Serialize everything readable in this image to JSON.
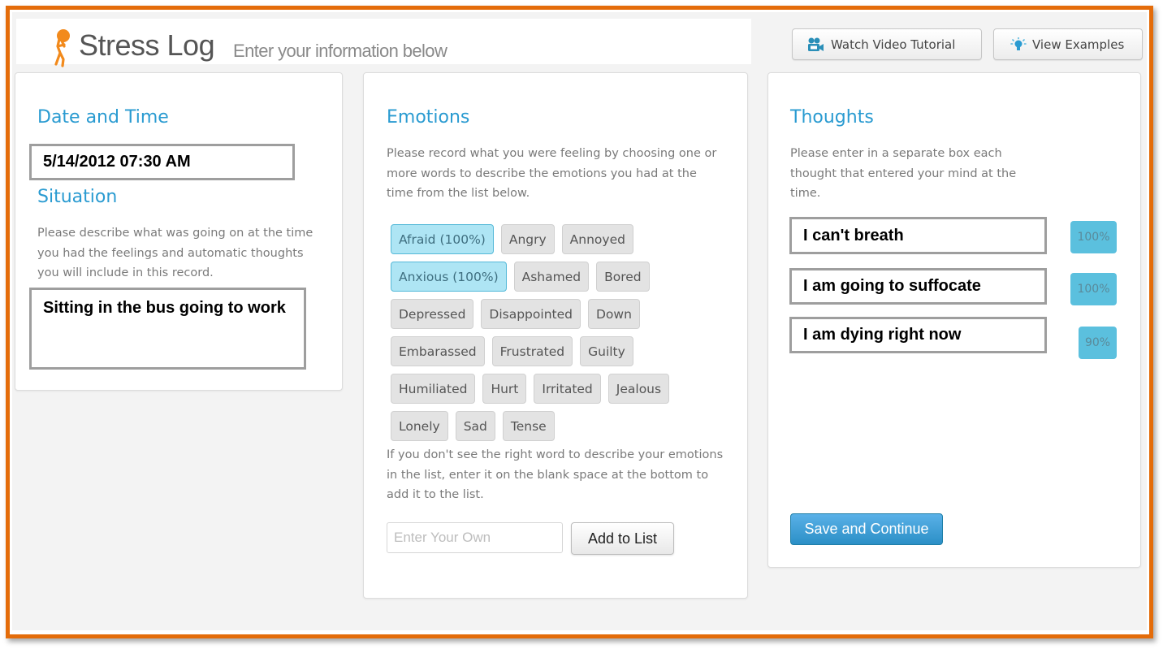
{
  "header": {
    "title": "Stress Log",
    "subtitle": "Enter your information below",
    "buttons": {
      "video_tutorial": {
        "label": "Watch Video Tutorial",
        "icon": "video-camera-icon"
      },
      "examples": {
        "label": "View Examples",
        "icon": "lightbulb-icon"
      }
    },
    "logo_icon": "person-carrying-ball-icon"
  },
  "datetime": {
    "heading": "Date and Time",
    "value": "5/14/2012   07:30 AM"
  },
  "situation": {
    "heading": "Situation",
    "description": "Please describe what was going on at the time you had the feelings and automatic thoughts you will include in this record.",
    "value": "Sitting in the bus going to work"
  },
  "emotions": {
    "heading": "Emotions",
    "description": "Please record what you were feeling by choosing one or more words to describe the emotions you had at the time from the list below.",
    "rows": [
      [
        {
          "label": "Afraid (100%)",
          "selected": true
        },
        {
          "label": "Angry",
          "selected": false
        },
        {
          "label": "Annoyed",
          "selected": false
        }
      ],
      [
        {
          "label": "Anxious (100%)",
          "selected": true
        },
        {
          "label": "Ashamed",
          "selected": false
        },
        {
          "label": "Bored",
          "selected": false
        }
      ],
      [
        {
          "label": "Depressed",
          "selected": false
        },
        {
          "label": "Disappointed",
          "selected": false
        },
        {
          "label": "Down",
          "selected": false
        }
      ],
      [
        {
          "label": "Embarassed",
          "selected": false
        },
        {
          "label": "Frustrated",
          "selected": false
        },
        {
          "label": "Guilty",
          "selected": false
        }
      ],
      [
        {
          "label": "Humiliated",
          "selected": false
        },
        {
          "label": "Hurt",
          "selected": false
        },
        {
          "label": "Irritated",
          "selected": false
        },
        {
          "label": "Jealous",
          "selected": false
        }
      ],
      [
        {
          "label": "Lonely",
          "selected": false
        },
        {
          "label": "Sad",
          "selected": false
        },
        {
          "label": "Tense",
          "selected": false
        }
      ]
    ],
    "add_hint": "If you don't see the right word to describe your emotions in the list, enter it on the blank space at the bottom to add it to the list.",
    "own_input": {
      "placeholder": "Enter Your Own",
      "value": ""
    },
    "add_button_label": "Add to List"
  },
  "thoughts": {
    "heading": "Thoughts",
    "description": "Please enter in a separate box each thought that entered your mind at the time.",
    "items": [
      {
        "text": "I can't breath",
        "belief": "100%"
      },
      {
        "text": "I am going to suffocate",
        "belief": "100%"
      },
      {
        "text": "I am dying right now",
        "belief": "90%"
      }
    ],
    "save_button_label": "Save and Continue"
  },
  "colors": {
    "frame_border": "#e46c0a",
    "accent_heading": "#2a9bd1",
    "selected_tag": "#aee5f4",
    "belief_badge": "#5bc0de",
    "primary_button": "#2b8fc6"
  }
}
